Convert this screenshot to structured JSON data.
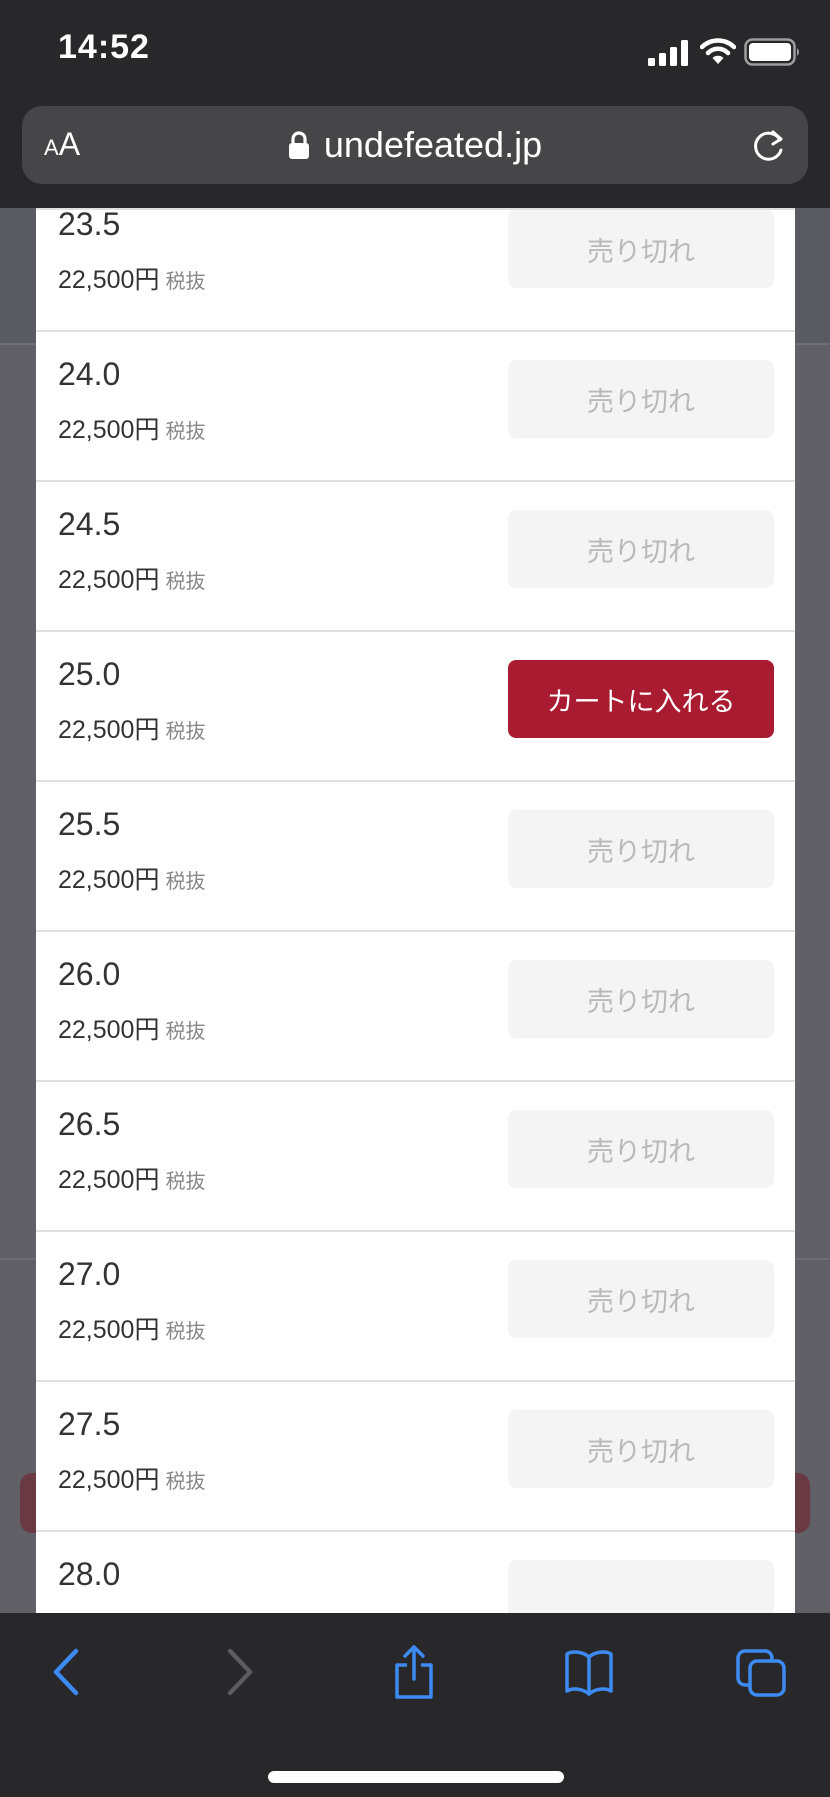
{
  "status_bar": {
    "time": "14:52"
  },
  "url_bar": {
    "text_size_label_small": "A",
    "text_size_label_large": "A",
    "url": "undefeated.jp"
  },
  "size_list": {
    "rows": [
      {
        "size": "23.5",
        "price": "22,500円",
        "tax": "税抜",
        "button": "売り切れ",
        "available": false
      },
      {
        "size": "24.0",
        "price": "22,500円",
        "tax": "税抜",
        "button": "売り切れ",
        "available": false
      },
      {
        "size": "24.5",
        "price": "22,500円",
        "tax": "税抜",
        "button": "売り切れ",
        "available": false
      },
      {
        "size": "25.0",
        "price": "22,500円",
        "tax": "税抜",
        "button": "カートに入れる",
        "available": true
      },
      {
        "size": "25.5",
        "price": "22,500円",
        "tax": "税抜",
        "button": "売り切れ",
        "available": false
      },
      {
        "size": "26.0",
        "price": "22,500円",
        "tax": "税抜",
        "button": "売り切れ",
        "available": false
      },
      {
        "size": "26.5",
        "price": "22,500円",
        "tax": "税抜",
        "button": "売り切れ",
        "available": false
      },
      {
        "size": "27.0",
        "price": "22,500円",
        "tax": "税抜",
        "button": "売り切れ",
        "available": false
      },
      {
        "size": "27.5",
        "price": "22,500円",
        "tax": "税抜",
        "button": "売り切れ",
        "available": false
      },
      {
        "size": "28.0",
        "price": "",
        "tax": "",
        "button": "",
        "available": false
      }
    ]
  },
  "toolbar": {
    "icons": [
      "back-icon",
      "forward-icon",
      "share-icon",
      "bookmarks-icon",
      "tabs-icon"
    ]
  },
  "colors": {
    "add_to_cart": "#a91b31",
    "soldout_bg": "#f4f4f4",
    "toolbar_icon": "#3d8bf2"
  }
}
